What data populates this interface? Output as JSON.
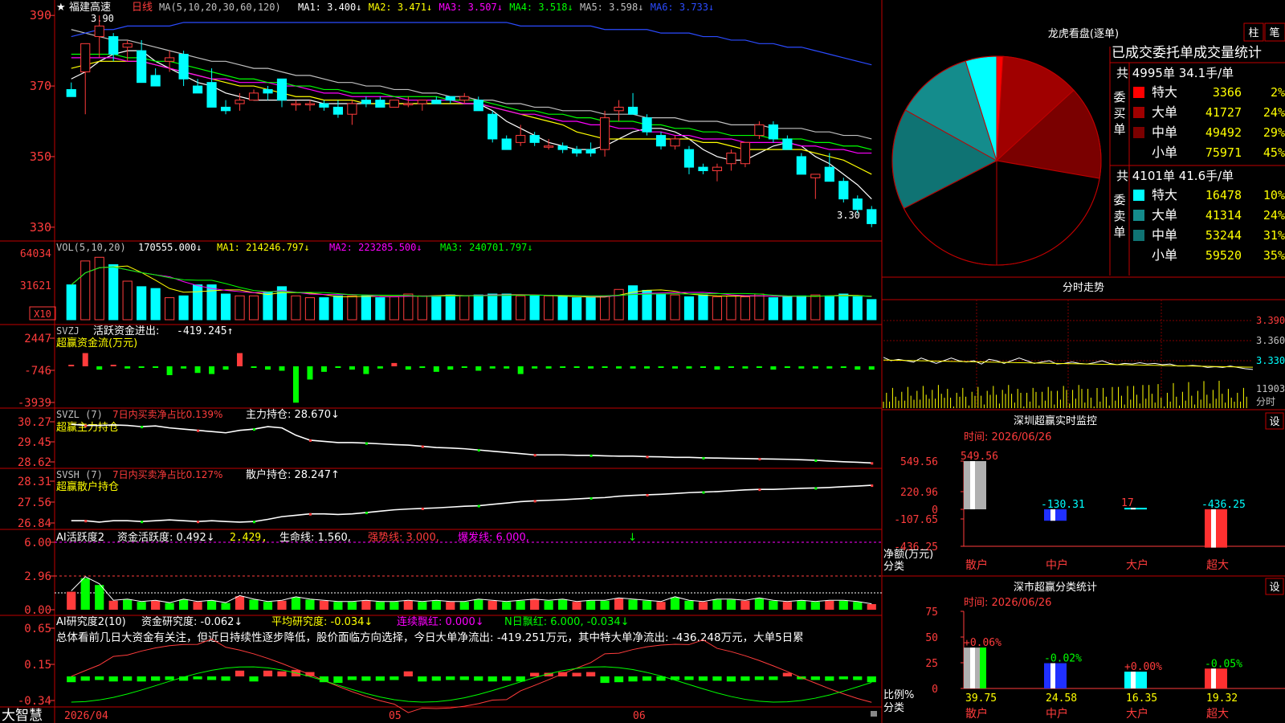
{
  "colors": {
    "up": "#ff3c3c",
    "down": "#00ffff",
    "green": "#00ff00",
    "bg": "#000000",
    "border": "#c00000",
    "grid": "#c00000",
    "white": "#ffffff",
    "yellow": "#ffff00",
    "magenta": "#ff00ff",
    "blue": "#2b4bff"
  },
  "header": {
    "star": "★",
    "stock_name": "福建高速",
    "period": "日线",
    "ma_label": "MA(5,10,20,30,60,120)",
    "ma": [
      {
        "text": "MA1: 3.400↓",
        "color": "#ffffff"
      },
      {
        "text": "MA2: 3.471↓",
        "color": "#ffff00"
      },
      {
        "text": "MA3: 3.507↓",
        "color": "#ff00ff"
      },
      {
        "text": "MA4: 3.518↓",
        "color": "#00ff00"
      },
      {
        "text": "MA5: 3.598↓",
        "color": "#c0c0c0"
      },
      {
        "text": "MA6: 3.733↓",
        "color": "#2b4bff"
      }
    ],
    "high_label": "3.90",
    "low_label": "3.30"
  },
  "price_axis": [
    "390",
    "370",
    "350",
    "330"
  ],
  "vol_header": {
    "label": "VOL(5,10,20)",
    "value": "170555.000↓",
    "ma1": "MA1: 214246.797↓",
    "ma2": "MA2: 223285.500↓",
    "ma3": "MA3: 240701.797↓"
  },
  "vol_axis": [
    "64034",
    "31621"
  ],
  "vol_unit": "X10",
  "svzj": {
    "name": "SVZJ",
    "label": "活跃资金进出:",
    "value": "-419.245↑",
    "sub": "超赢资金流(万元)",
    "axis": [
      "2447",
      "-746",
      "-3939"
    ]
  },
  "svzl": {
    "name": "SVZL (7)",
    "label": "7日内买卖净占比0.139%",
    "hold": "主力持仓: 28.670↓",
    "sub": "超赢主力持仓",
    "axis": [
      "30.27",
      "29.45",
      "28.62"
    ]
  },
  "svsh": {
    "name": "SVSH (7)",
    "label": "7日内买卖净占比0.127%",
    "hold": "散户持仓: 28.247↑",
    "sub": "超赢散户持仓",
    "axis": [
      "28.31",
      "27.56",
      "26.84"
    ]
  },
  "ai1": {
    "name": "AI活跃度2",
    "v1": "资金活跃度: 0.492↓",
    "v2": "2.429,",
    "v3": "生命线: 1.560,",
    "v4": "强势线: 3.000,",
    "v5": "爆发线: 6.000,",
    "arrow": "↓",
    "axis": [
      "6.00",
      "2.96",
      "0.00"
    ]
  },
  "ai2": {
    "name": "AI研究度2(10)",
    "v1": "资金研究度: -0.062↓",
    "v2": "平均研究度: -0.034↓",
    "v3": "连续飘红: 0.000↓",
    "v4": "N日飘红: 6.000, -0.034↓",
    "text": "总体看前几日大资金有关注，但近日持续性逐步降低，股价面临方向选择，今日大单净流出: -419.251万元，其中特大单净流出: -436.248万元，大单5日累",
    "axis": [
      "0.65",
      "0.15",
      "-0.34"
    ]
  },
  "bottom": {
    "brand": "大智慧",
    "dates": [
      "2026/04",
      "05",
      "06"
    ]
  },
  "longhu": {
    "title": "龙虎看盘(逐单)",
    "tab1": "柱",
    "tab2": "笔",
    "subtitle": "已成交委托单成交量统计",
    "buy": {
      "side": "委买单",
      "summary": "共 4995单 34.1手/单",
      "rows": [
        {
          "label": "特大",
          "value": "3366",
          "pct": "2%",
          "color": "#ff0000"
        },
        {
          "label": "大单",
          "value": "41727",
          "pct": "24%",
          "color": "#a00000"
        },
        {
          "label": "中单",
          "value": "49492",
          "pct": "29%",
          "color": "#7a0000"
        },
        {
          "label": "小单",
          "value": "75971",
          "pct": "45%",
          "color": "#000000"
        }
      ]
    },
    "sell": {
      "side": "委卖单",
      "summary": "共 4101单 41.6手/单",
      "rows": [
        {
          "label": "特大",
          "value": "16478",
          "pct": "10%",
          "color": "#00ffff"
        },
        {
          "label": "大单",
          "value": "41314",
          "pct": "24%",
          "color": "#148c8c"
        },
        {
          "label": "中单",
          "value": "53244",
          "pct": "31%",
          "color": "#0f7373"
        },
        {
          "label": "小单",
          "value": "59520",
          "pct": "35%",
          "color": "#000000"
        }
      ]
    }
  },
  "intraday": {
    "title": "分时走势",
    "axis": [
      "3.390",
      "3.360",
      "3.330"
    ],
    "vol_axis": "11903",
    "unit": "分时"
  },
  "sz_monitor": {
    "title": "深圳超赢实时监控",
    "setting": "设",
    "time": "时间: 2026/06/26",
    "axis": [
      "549.56",
      "220.96",
      "0",
      "-107.65",
      "-436.25"
    ],
    "unit": "净额(万元)",
    "unit2": "分类",
    "categories": [
      "散户",
      "中户",
      "大户",
      "超大"
    ],
    "values": [
      549.56,
      -130.31,
      17,
      -436.25
    ],
    "labels": [
      "549.56",
      "-130.31",
      "17",
      "-436.25"
    ]
  },
  "sz_stats": {
    "title": "深市超赢分类统计",
    "setting": "设",
    "time": "时间: 2026/06/26",
    "axis": [
      "75",
      "50",
      "25",
      "0"
    ],
    "unit": "比例%",
    "unit2": "分类",
    "categories": [
      "散户",
      "中户",
      "大户",
      "超大"
    ],
    "values": [
      39.75,
      24.58,
      16.35,
      19.32
    ],
    "changes": [
      "+0.06%",
      "-0.02%",
      "+0.00%",
      "-0.05%"
    ],
    "labels": [
      "39.75",
      "24.58",
      "16.35",
      "19.32"
    ]
  },
  "candles": [
    [
      3.69,
      3.71,
      3.67,
      3.67
    ],
    [
      3.74,
      3.8,
      3.62,
      3.82
    ],
    [
      3.84,
      3.9,
      3.78,
      3.87
    ],
    [
      3.84,
      3.85,
      3.77,
      3.79
    ],
    [
      3.81,
      3.83,
      3.77,
      3.82
    ],
    [
      3.8,
      3.83,
      3.72,
      3.71
    ],
    [
      3.73,
      3.75,
      3.7,
      3.7
    ],
    [
      3.77,
      3.8,
      3.74,
      3.78
    ],
    [
      3.79,
      3.8,
      3.7,
      3.72
    ],
    [
      3.7,
      3.72,
      3.68,
      3.68
    ],
    [
      3.71,
      3.75,
      3.64,
      3.64
    ],
    [
      3.64,
      3.66,
      3.62,
      3.63
    ],
    [
      3.65,
      3.68,
      3.63,
      3.66
    ],
    [
      3.66,
      3.69,
      3.66,
      3.68
    ],
    [
      3.69,
      3.7,
      3.66,
      3.68
    ],
    [
      3.72,
      3.72,
      3.64,
      3.66
    ],
    [
      3.65,
      3.66,
      3.63,
      3.65
    ],
    [
      3.65,
      3.66,
      3.63,
      3.65
    ],
    [
      3.65,
      3.66,
      3.63,
      3.64
    ],
    [
      3.64,
      3.66,
      3.61,
      3.62
    ],
    [
      3.62,
      3.66,
      3.59,
      3.65
    ],
    [
      3.66,
      3.67,
      3.64,
      3.65
    ],
    [
      3.66,
      3.67,
      3.64,
      3.64
    ],
    [
      3.64,
      3.66,
      3.64,
      3.66
    ],
    [
      3.65,
      3.67,
      3.64,
      3.65
    ],
    [
      3.65,
      3.66,
      3.63,
      3.66
    ],
    [
      3.66,
      3.67,
      3.65,
      3.65
    ],
    [
      3.67,
      3.67,
      3.65,
      3.66
    ],
    [
      3.66,
      3.68,
      3.65,
      3.67
    ],
    [
      3.66,
      3.67,
      3.63,
      3.63
    ],
    [
      3.62,
      3.63,
      3.54,
      3.55
    ],
    [
      3.55,
      3.56,
      3.52,
      3.52
    ],
    [
      3.54,
      3.59,
      3.53,
      3.56
    ],
    [
      3.56,
      3.57,
      3.53,
      3.54
    ],
    [
      3.53,
      3.55,
      3.52,
      3.53
    ],
    [
      3.53,
      3.54,
      3.51,
      3.52
    ],
    [
      3.52,
      3.53,
      3.5,
      3.51
    ],
    [
      3.52,
      3.54,
      3.5,
      3.51
    ],
    [
      3.52,
      3.63,
      3.5,
      3.61
    ],
    [
      3.63,
      3.66,
      3.6,
      3.64
    ],
    [
      3.64,
      3.68,
      3.63,
      3.62
    ],
    [
      3.61,
      3.62,
      3.56,
      3.57
    ],
    [
      3.56,
      3.57,
      3.52,
      3.53
    ],
    [
      3.53,
      3.56,
      3.52,
      3.55
    ],
    [
      3.52,
      3.53,
      3.45,
      3.47
    ],
    [
      3.47,
      3.48,
      3.45,
      3.46
    ],
    [
      3.46,
      3.48,
      3.43,
      3.47
    ],
    [
      3.48,
      3.52,
      3.46,
      3.51
    ],
    [
      3.48,
      3.51,
      3.47,
      3.54
    ],
    [
      3.56,
      3.6,
      3.55,
      3.59
    ],
    [
      3.59,
      3.6,
      3.54,
      3.55
    ],
    [
      3.55,
      3.56,
      3.52,
      3.52
    ],
    [
      3.5,
      3.51,
      3.45,
      3.45
    ],
    [
      3.44,
      3.45,
      3.38,
      3.45
    ],
    [
      3.47,
      3.51,
      3.45,
      3.43
    ],
    [
      3.43,
      3.44,
      3.37,
      3.38
    ],
    [
      3.38,
      3.39,
      3.34,
      3.35
    ],
    [
      3.35,
      3.36,
      3.3,
      3.31
    ]
  ],
  "ma_lines": [
    {
      "color": "#ffffff",
      "values": [
        3.72,
        3.74,
        3.77,
        3.79,
        3.8,
        3.8,
        3.77,
        3.75,
        3.73,
        3.71,
        3.7,
        3.68,
        3.67,
        3.66,
        3.66,
        3.66,
        3.66,
        3.66,
        3.65,
        3.65,
        3.65,
        3.65,
        3.65,
        3.65,
        3.65,
        3.65,
        3.65,
        3.65,
        3.65,
        3.65,
        3.63,
        3.6,
        3.58,
        3.56,
        3.54,
        3.53,
        3.52,
        3.52,
        3.53,
        3.55,
        3.57,
        3.58,
        3.58,
        3.57,
        3.55,
        3.52,
        3.5,
        3.49,
        3.49,
        3.51,
        3.53,
        3.54,
        3.53,
        3.5,
        3.48,
        3.45,
        3.42,
        3.38
      ]
    },
    {
      "color": "#ffff00",
      "values": [
        3.75,
        3.76,
        3.77,
        3.77,
        3.77,
        3.77,
        3.76,
        3.75,
        3.74,
        3.73,
        3.72,
        3.71,
        3.7,
        3.7,
        3.69,
        3.68,
        3.67,
        3.67,
        3.66,
        3.66,
        3.66,
        3.65,
        3.65,
        3.65,
        3.65,
        3.65,
        3.65,
        3.65,
        3.65,
        3.65,
        3.64,
        3.63,
        3.62,
        3.61,
        3.6,
        3.59,
        3.57,
        3.56,
        3.55,
        3.55,
        3.55,
        3.55,
        3.55,
        3.55,
        3.55,
        3.54,
        3.54,
        3.53,
        3.52,
        3.52,
        3.52,
        3.52,
        3.52,
        3.51,
        3.5,
        3.49,
        3.47,
        3.45
      ]
    },
    {
      "color": "#ff00ff",
      "values": [
        3.78,
        3.78,
        3.78,
        3.78,
        3.77,
        3.77,
        3.76,
        3.75,
        3.74,
        3.73,
        3.72,
        3.72,
        3.71,
        3.71,
        3.71,
        3.7,
        3.7,
        3.69,
        3.68,
        3.68,
        3.67,
        3.67,
        3.67,
        3.67,
        3.66,
        3.66,
        3.66,
        3.66,
        3.65,
        3.65,
        3.64,
        3.63,
        3.62,
        3.62,
        3.61,
        3.6,
        3.6,
        3.59,
        3.59,
        3.58,
        3.58,
        3.57,
        3.57,
        3.56,
        3.56,
        3.55,
        3.55,
        3.55,
        3.54,
        3.54,
        3.54,
        3.54,
        3.53,
        3.53,
        3.52,
        3.52,
        3.51,
        3.51
      ]
    },
    {
      "color": "#00ff00",
      "values": [
        3.79,
        3.79,
        3.79,
        3.79,
        3.78,
        3.78,
        3.77,
        3.77,
        3.76,
        3.75,
        3.74,
        3.73,
        3.72,
        3.72,
        3.71,
        3.71,
        3.7,
        3.7,
        3.69,
        3.69,
        3.68,
        3.68,
        3.68,
        3.67,
        3.67,
        3.67,
        3.67,
        3.66,
        3.66,
        3.66,
        3.65,
        3.64,
        3.63,
        3.63,
        3.62,
        3.62,
        3.61,
        3.61,
        3.6,
        3.6,
        3.6,
        3.59,
        3.59,
        3.58,
        3.58,
        3.57,
        3.57,
        3.56,
        3.56,
        3.56,
        3.55,
        3.55,
        3.55,
        3.54,
        3.54,
        3.53,
        3.53,
        3.52
      ]
    },
    {
      "color": "#c0c0c0",
      "values": [
        3.86,
        3.85,
        3.84,
        3.83,
        3.83,
        3.82,
        3.81,
        3.8,
        3.79,
        3.78,
        3.77,
        3.77,
        3.76,
        3.75,
        3.75,
        3.74,
        3.73,
        3.73,
        3.72,
        3.71,
        3.71,
        3.7,
        3.7,
        3.69,
        3.69,
        3.68,
        3.68,
        3.67,
        3.67,
        3.66,
        3.66,
        3.65,
        3.65,
        3.64,
        3.64,
        3.63,
        3.63,
        3.63,
        3.62,
        3.62,
        3.62,
        3.61,
        3.61,
        3.61,
        3.6,
        3.6,
        3.6,
        3.59,
        3.59,
        3.59,
        3.58,
        3.58,
        3.58,
        3.57,
        3.57,
        3.56,
        3.56,
        3.55
      ]
    },
    {
      "color": "#2b4bff",
      "values": [
        3.84,
        3.85,
        3.86,
        3.86,
        3.87,
        3.87,
        3.87,
        3.87,
        3.88,
        3.88,
        3.88,
        3.88,
        3.88,
        3.88,
        3.88,
        3.88,
        3.88,
        3.88,
        3.88,
        3.88,
        3.88,
        3.88,
        3.88,
        3.88,
        3.88,
        3.88,
        3.88,
        3.88,
        3.88,
        3.88,
        3.88,
        3.88,
        3.87,
        3.87,
        3.87,
        3.87,
        3.87,
        3.87,
        3.86,
        3.86,
        3.86,
        3.86,
        3.85,
        3.85,
        3.85,
        3.84,
        3.84,
        3.83,
        3.83,
        3.82,
        3.82,
        3.81,
        3.81,
        3.8,
        3.79,
        3.78,
        3.77,
        3.76
      ]
    }
  ],
  "volumes": [
    380,
    640,
    680,
    600,
    420,
    360,
    340,
    240,
    260,
    380,
    380,
    280,
    260,
    260,
    300,
    360,
    260,
    240,
    240,
    260,
    260,
    260,
    240,
    250,
    280,
    260,
    260,
    270,
    260,
    270,
    280,
    280,
    260,
    260,
    260,
    250,
    240,
    240,
    260,
    330,
    370,
    320,
    280,
    270,
    250,
    270,
    250,
    260,
    250,
    280,
    240,
    250,
    260,
    270,
    260,
    280,
    250,
    220
  ],
  "svzj_values": [
    0,
    1200,
    -300,
    100,
    -200,
    -100,
    -100,
    -800,
    -200,
    -600,
    -700,
    -300,
    1200,
    -100,
    -300,
    -400,
    -3300,
    -1200,
    -500,
    -50,
    -300,
    -700,
    -200,
    300,
    -300,
    -150,
    -500,
    -300,
    -100,
    -400,
    -200,
    -200,
    -700,
    -200,
    -200,
    -100,
    -100,
    -200,
    -100,
    -200,
    -200,
    -200,
    -100,
    -200,
    -200,
    -100,
    -300,
    -100,
    -200,
    -100,
    -300,
    -150,
    -200,
    -200,
    -200,
    -150,
    -300,
    -300
  ],
  "svzl_values": [
    30.25,
    30.2,
    30.2,
    30.22,
    30.2,
    30.15,
    30.18,
    30.1,
    30.05,
    30.0,
    29.95,
    29.9,
    30.0,
    30.05,
    30.15,
    30.1,
    29.8,
    29.6,
    29.55,
    29.5,
    29.5,
    29.48,
    29.45,
    29.42,
    29.4,
    29.35,
    29.3,
    29.28,
    29.25,
    29.2,
    29.15,
    29.1,
    29.05,
    29.0,
    29.0,
    29.0,
    28.98,
    28.98,
    28.96,
    28.95,
    28.95,
    28.93,
    28.92,
    28.9,
    28.9,
    28.88,
    28.87,
    28.86,
    28.85,
    28.84,
    28.83,
    28.82,
    28.8,
    28.78,
    28.75,
    28.72,
    28.7,
    28.67
  ],
  "svsh_values": [
    26.95,
    26.95,
    26.9,
    26.95,
    26.95,
    26.92,
    26.95,
    26.98,
    26.95,
    26.92,
    26.95,
    26.92,
    26.9,
    26.92,
    27.0,
    27.1,
    27.15,
    27.2,
    27.2,
    27.18,
    27.2,
    27.25,
    27.3,
    27.35,
    27.38,
    27.4,
    27.42,
    27.45,
    27.48,
    27.5,
    27.55,
    27.6,
    27.65,
    27.68,
    27.7,
    27.72,
    27.75,
    27.78,
    27.8,
    27.85,
    27.88,
    27.9,
    27.92,
    27.95,
    27.98,
    28.0,
    28.02,
    28.05,
    28.08,
    28.1,
    28.1,
    28.12,
    28.14,
    28.15,
    28.17,
    28.2,
    28.22,
    28.25
  ],
  "ai1_values": [
    1.6,
    2.8,
    2.2,
    0.8,
    0.9,
    0.7,
    0.8,
    0.6,
    0.9,
    0.7,
    0.8,
    0.6,
    1.2,
    0.9,
    0.7,
    0.8,
    1.1,
    0.9,
    0.8,
    0.7,
    0.7,
    0.8,
    0.7,
    0.7,
    0.8,
    0.7,
    0.8,
    0.7,
    0.7,
    0.9,
    0.8,
    0.7,
    0.8,
    0.9,
    0.8,
    0.9,
    0.7,
    0.8,
    0.8,
    1.0,
    0.9,
    0.8,
    0.7,
    1.1,
    0.8,
    0.7,
    0.9,
    0.9,
    0.8,
    1.0,
    0.8,
    0.7,
    0.8,
    0.7,
    0.8,
    0.8,
    0.7,
    0.5
  ],
  "ai2_values": [
    -0.08,
    -0.06,
    -0.05,
    -0.07,
    -0.06,
    -0.07,
    -0.06,
    -0.05,
    -0.06,
    -0.04,
    -0.05,
    -0.06,
    0.08,
    -0.07,
    0.08,
    0.07,
    0.09,
    0.06,
    -0.08,
    -0.09,
    -0.05,
    -0.06,
    -0.06,
    -0.05,
    0.07,
    -0.07,
    -0.06,
    -0.05,
    -0.05,
    -0.06,
    -0.07,
    -0.06,
    -0.07,
    0.05,
    0.05,
    0.06,
    0.05,
    0.06,
    -0.09,
    -0.08,
    -0.07,
    -0.06,
    -0.06,
    -0.05,
    -0.05,
    -0.06,
    -0.06,
    -0.07,
    -0.06,
    -0.05,
    -0.05,
    0.05,
    -0.04,
    -0.05,
    -0.06,
    -0.04,
    -0.05,
    -0.08
  ],
  "intraday_prices": [
    3.335,
    3.33,
    3.332,
    3.33,
    3.328,
    3.334,
    3.33,
    3.326,
    3.33,
    3.334,
    3.33,
    3.328,
    3.33,
    3.325,
    3.332,
    3.33,
    3.326,
    3.33,
    3.334,
    3.33,
    3.326,
    3.328,
    3.33,
    3.325,
    3.326,
    3.328,
    3.326,
    3.325,
    3.327,
    3.33,
    3.326,
    3.324,
    3.326,
    3.325,
    3.327,
    3.325,
    3.326,
    3.324,
    3.325,
    3.322,
    3.322,
    3.323,
    3.322,
    3.32,
    3.321,
    3.32,
    3.322,
    3.32,
    3.318,
    3.317
  ]
}
